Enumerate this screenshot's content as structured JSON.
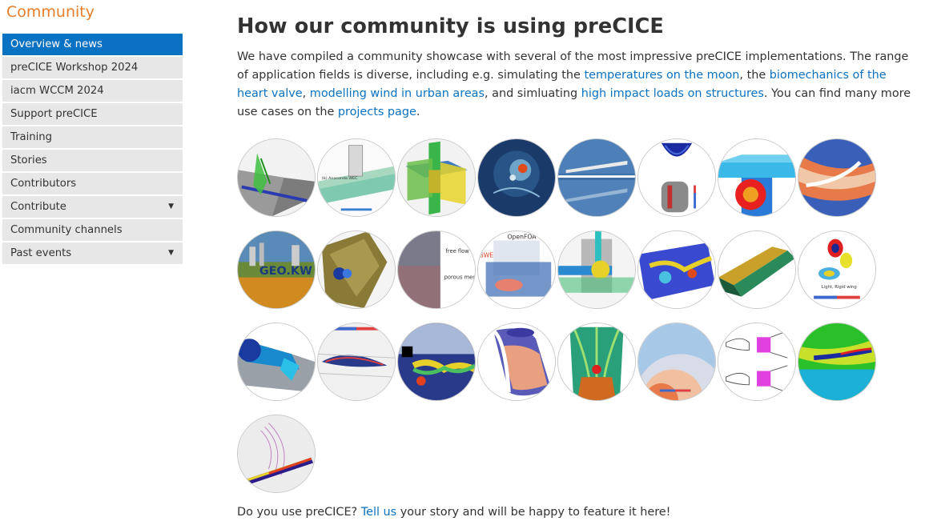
{
  "sidebar": {
    "title": "Community",
    "items": [
      {
        "label": "Overview & news",
        "active": true,
        "caret": ""
      },
      {
        "label": "preCICE Workshop 2024",
        "caret": ""
      },
      {
        "label": "iacm WCCM 2024",
        "caret": ""
      },
      {
        "label": "Support preCICE",
        "caret": ""
      },
      {
        "label": "Training",
        "caret": ""
      },
      {
        "label": "Stories",
        "caret": ""
      },
      {
        "label": "Contributors",
        "caret": ""
      },
      {
        "label": "Contribute",
        "caret": "▼"
      },
      {
        "label": "Community channels",
        "caret": ""
      },
      {
        "label": "Past events",
        "caret": "▼"
      }
    ]
  },
  "main": {
    "title": "How our community is using preCICE",
    "intro": {
      "t1": "We have compiled a community showcase with several of the most impressive preCICE implementations. The range of application fields is diverse, including e.g. simulating the ",
      "l1": "temperatures on the moon",
      "t2": ", the ",
      "l2": "biomechanics of the heart valve",
      "t3": ", ",
      "l3": "modelling wind in urban areas",
      "t4": ", and simluating ",
      "l4": "high impact loads on structures",
      "t5": ". You can find many more use cases on the ",
      "l5": "projects page",
      "t6": "."
    },
    "footer": {
      "t1": "Do you use preCICE? ",
      "link": "Tell us",
      "t2": " your story and will be happy to feature it here!"
    },
    "thumb_text": {
      "wec_label": "(b) Anaconda WEC",
      "geo": "GEO.KW",
      "free_flow": "free flow",
      "porous": "porous medium",
      "openfoam": "OpenFOA",
      "swe": "SWE",
      "rigid": "Light, Rigid wing"
    }
  },
  "colors": {
    "accent": "#0a72c2",
    "brand_orange": "#e87e2b",
    "nav_bg": "#e7e7e7"
  }
}
